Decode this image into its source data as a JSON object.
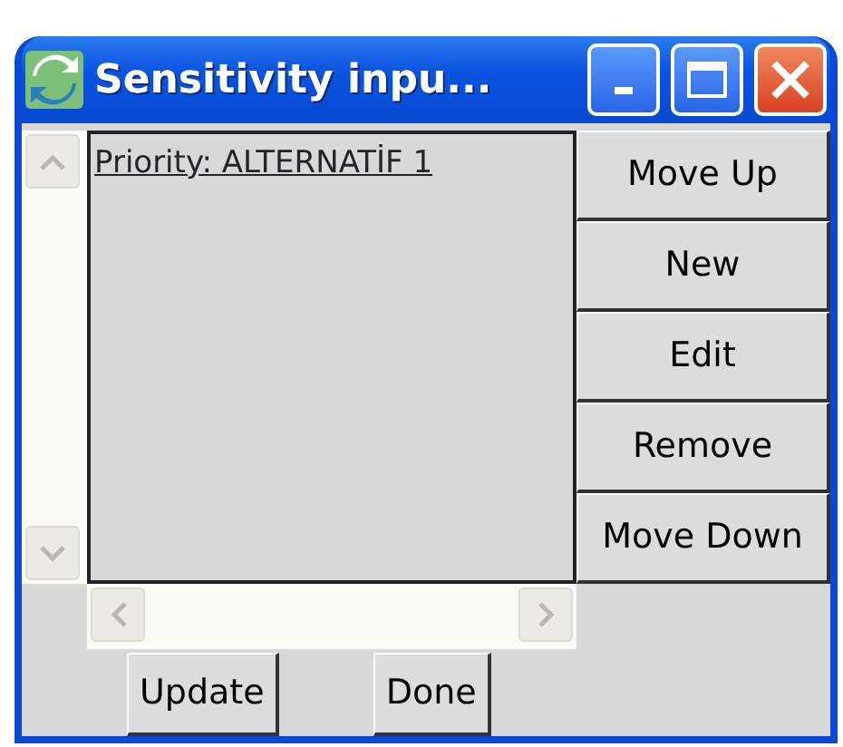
{
  "window": {
    "title": "Sensitivity inpu..."
  },
  "list": {
    "items": [
      {
        "text": "Priority: ALTERNATİF 1"
      }
    ]
  },
  "side_buttons": [
    {
      "label": "Move Up"
    },
    {
      "label": "New"
    },
    {
      "label": "Edit"
    },
    {
      "label": "Remove"
    },
    {
      "label": "Move Down"
    }
  ],
  "bottom_buttons": [
    {
      "label": "Update"
    },
    {
      "label": "Done"
    }
  ]
}
